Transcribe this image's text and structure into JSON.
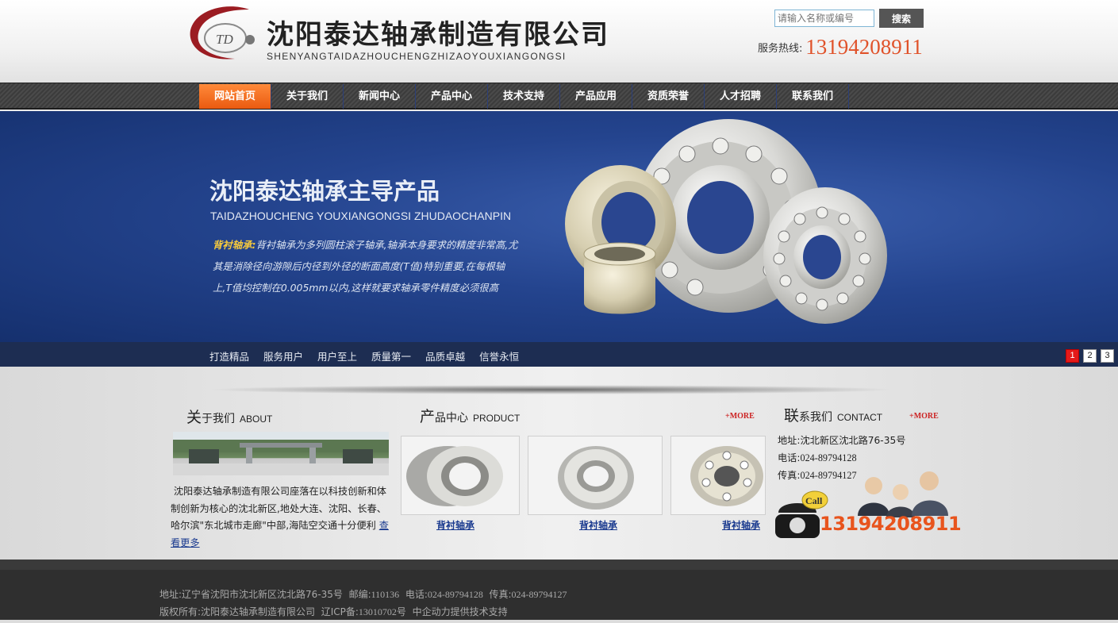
{
  "header": {
    "company_cn": "沈阳泰达轴承制造有限公司",
    "company_en": "SHENYANGTAIDAZHOUCHENGZHIZAOYOUXIANGONGSI",
    "logo_text": "TD",
    "search_placeholder": "请输入名称或编号",
    "search_button": "搜索",
    "hotline_label": "服务热线:",
    "hotline_number": "13194208911"
  },
  "nav": {
    "items": [
      "网站首页",
      "关于我们",
      "新闻中心",
      "产品中心",
      "技术支持",
      "产品应用",
      "资质荣誉",
      "人才招聘",
      "联系我们"
    ],
    "active_index": 0
  },
  "banner": {
    "title": "沈阳泰达轴承主导产品",
    "subtitle": "TAIDAZHOUCHENG YOUXIANGONGSI ZHUDAOCHANPIN",
    "desc_highlight": "背衬轴承:",
    "desc_text": "背衬轴承为多列圆柱滚子轴承,轴承本身要求的精度非常高,尤其是消除径向游隙后内径到外径的断面高度(T值)特别重要,在每根轴上,T值均控制在0.005mm以内,这样就要求轴承零件精度必须很高",
    "slogans": [
      "打造精品",
      "服务用户",
      "用户至上",
      "质量第一",
      "品质卓越",
      "信誉永恒"
    ],
    "pager": [
      "1",
      "2",
      "3"
    ],
    "active_slide": 0
  },
  "about": {
    "title_big": "关",
    "title_rest": "于我们",
    "title_en": "ABOUT",
    "text": "沈阳泰达轴承制造有限公司座落在以科技创新和体制创新为核心的沈北新区,地处大连、沈阳、长春、哈尔滨\"东北城市走廊\"中部,海陆空交通十分便利",
    "more_link": "查看更多"
  },
  "products": {
    "title_big": "产",
    "title_rest": "品中心",
    "title_en": "PRODUCT",
    "more": "+MORE",
    "items": [
      {
        "name": "背衬轴承"
      },
      {
        "name": "背衬轴承"
      },
      {
        "name": "背衬轴承"
      }
    ]
  },
  "contact": {
    "title_big": "联",
    "title_rest": "系我们",
    "title_en": "CONTACT",
    "more": "+MORE",
    "address_label": "地址:",
    "address": "沈北新区沈北路76-35号",
    "phone_label": "电话:",
    "phone": "024-89794128",
    "fax_label": "传真:",
    "fax": "024-89794127",
    "call_text": "Call",
    "big_number": "13194208911"
  },
  "footer": {
    "line1": {
      "address_label": "地址:",
      "address": "辽宁省沈阳市沈北新区沈北路76-35号",
      "zip_label": "邮编:",
      "zip": "110136",
      "phone_label": "电话:",
      "phone": "024-89794128",
      "fax_label": "传真:",
      "fax": "024-89794127"
    },
    "line2": {
      "copyright_label": "版权所有:",
      "copyright": "沈阳泰达轴承制造有限公司",
      "icp_label": "辽ICP备:",
      "icp": "13010702号",
      "support": "中企动力提供技术支持"
    }
  },
  "colors": {
    "accent_orange": "#e0522a",
    "nav_active": "#ff7a28",
    "banner_blue": "#24448e",
    "link_blue": "#1a3a8f",
    "more_red": "#cc2222",
    "pager_active": "#e41a1a"
  }
}
